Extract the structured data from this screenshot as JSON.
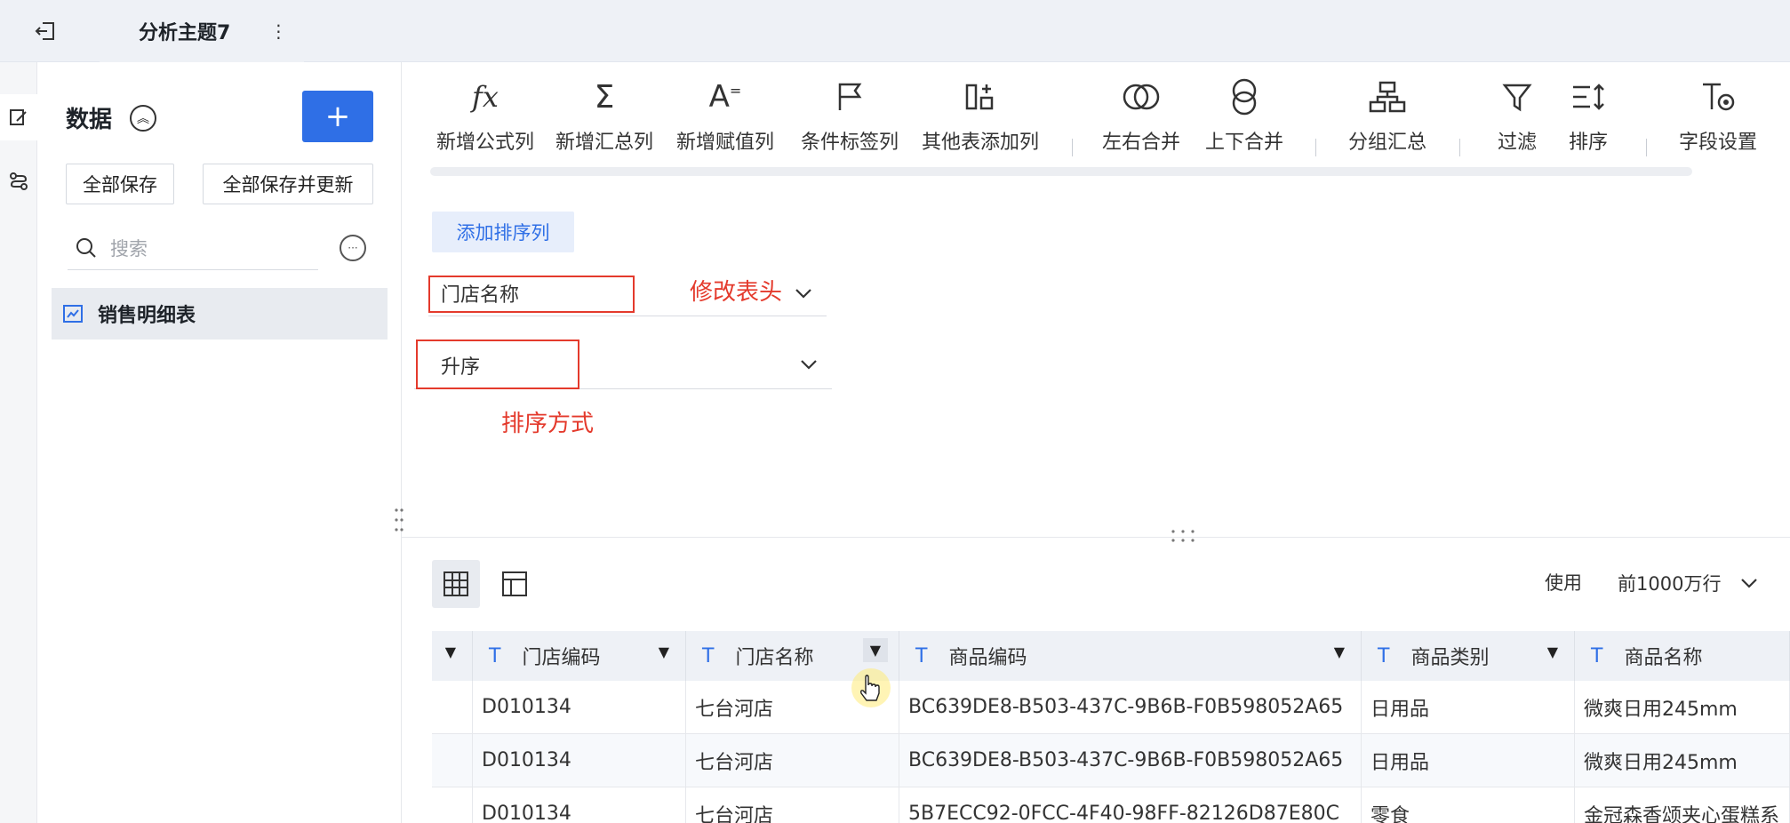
{
  "topbar": {
    "tab_title": "分析主题7"
  },
  "sidebar": {
    "title": "数据",
    "add_label": "+",
    "save_all": "全部保存",
    "save_all_update": "全部保存并更新",
    "search_placeholder": "搜索",
    "items": [
      {
        "label": "销售明细表"
      }
    ]
  },
  "toolbar": {
    "tools": [
      {
        "label": "新增公式列",
        "icon": "fx-icon"
      },
      {
        "label": "新增汇总列",
        "icon": "sigma-icon"
      },
      {
        "label": "新增赋值列",
        "icon": "assign-icon"
      },
      {
        "label": "条件标签列",
        "icon": "flag-icon"
      },
      {
        "label": "其他表添加列",
        "icon": "add-column-icon"
      },
      {
        "label": "左右合并",
        "icon": "join-lr-icon"
      },
      {
        "label": "上下合并",
        "icon": "union-icon"
      },
      {
        "label": "分组汇总",
        "icon": "group-icon"
      },
      {
        "label": "过滤",
        "icon": "filter-icon"
      },
      {
        "label": "排序",
        "icon": "sort-icon"
      },
      {
        "label": "字段设置",
        "icon": "field-settings-icon"
      }
    ]
  },
  "sort_panel": {
    "add_sort_label": "添加排序列",
    "field_value": "门店名称",
    "order_value": "升序",
    "annotation_header": "修改表头",
    "annotation_order": "排序方式"
  },
  "preview": {
    "usage_label": "使用",
    "row_limit": "前1000万行"
  },
  "table": {
    "type_icon": "T",
    "columns": [
      "门店编码",
      "门店名称",
      "商品编码",
      "商品类别",
      "商品名称"
    ],
    "rows": [
      [
        "D010134",
        "七台河店",
        "BC639DE8-B503-437C-9B6B-F0B598052A65",
        "日用品",
        "微爽日用245mm"
      ],
      [
        "D010134",
        "七台河店",
        "BC639DE8-B503-437C-9B6B-F0B598052A65",
        "日用品",
        "微爽日用245mm"
      ],
      [
        "D010134",
        "七台河店",
        "5B7ECC92-0FCC-4F40-98FF-82126D87E80C",
        "零食",
        "金冠森香颂夹心蛋糕系"
      ]
    ]
  },
  "colors": {
    "accent": "#2f6fe6",
    "annotation": "#e43a2c"
  }
}
